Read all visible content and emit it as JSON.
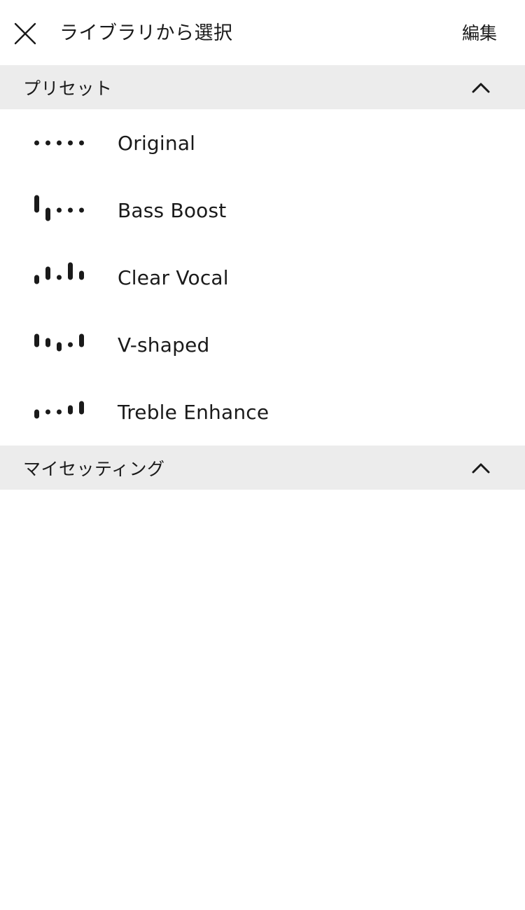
{
  "header": {
    "title": "ライブラリから選択",
    "edit_label": "編集",
    "close_icon": "close-icon"
  },
  "sections": [
    {
      "title": "プリセット",
      "expanded": true,
      "items": [
        {
          "label": "Original",
          "eq_levels": [
            0,
            0,
            0,
            0,
            0
          ]
        },
        {
          "label": "Bass Boost",
          "eq_levels": [
            3,
            -2,
            0,
            0,
            0
          ]
        },
        {
          "label": "Clear Vocal",
          "eq_levels": [
            -1,
            2,
            0,
            3,
            1
          ]
        },
        {
          "label": "V-shaped",
          "eq_levels": [
            2,
            1,
            -1,
            0,
            2
          ]
        },
        {
          "label": "Treble Enhance",
          "eq_levels": [
            -1,
            0,
            0,
            1,
            2
          ]
        }
      ]
    },
    {
      "title": "マイセッティング",
      "expanded": true,
      "items": []
    }
  ],
  "colors": {
    "text": "#1a1a1a",
    "section_bg": "#ececec",
    "background": "#ffffff"
  }
}
